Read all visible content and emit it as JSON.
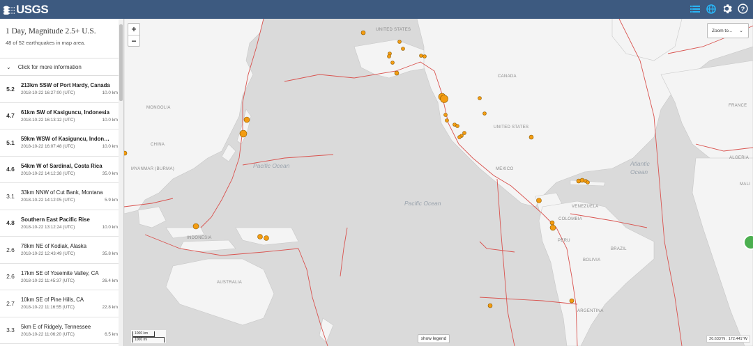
{
  "header": {
    "logo_text": "USGS",
    "icons": [
      "list-icon",
      "globe-icon",
      "gear-icon",
      "help-icon"
    ]
  },
  "sidebar": {
    "title": "1 Day, Magnitude 2.5+ U.S.",
    "subtitle": "48 of 52 earthquakes in map area.",
    "more_info": "Click for more information",
    "earthquakes": [
      {
        "mag": "5.2",
        "place": "213km SSW of Port Hardy, Canada",
        "time": "2018-10-22 16:27:00 (UTC)",
        "depth": "10.0 km"
      },
      {
        "mag": "4.7",
        "place": "61km SW of Kasiguncu, Indonesia",
        "time": "2018-10-22 16:13:12 (UTC)",
        "depth": "10.0 km"
      },
      {
        "mag": "5.1",
        "place": "59km WSW of Kasiguncu, Indon…",
        "time": "2018-10-22 16:07:48 (UTC)",
        "depth": "10.0 km"
      },
      {
        "mag": "4.6",
        "place": "54km W of Sardinal, Costa Rica",
        "time": "2018-10-22 14:12:38 (UTC)",
        "depth": "35.0 km"
      },
      {
        "mag": "3.1",
        "place": "33km NNW of Cut Bank, Montana",
        "time": "2018-10-22 14:12:05 (UTC)",
        "depth": "5.9 km"
      },
      {
        "mag": "4.8",
        "place": "Southern East Pacific Rise",
        "time": "2018-10-22 13:12:24 (UTC)",
        "depth": "10.0 km"
      },
      {
        "mag": "2.6",
        "place": "78km NE of Kodiak, Alaska",
        "time": "2018-10-22 12:43:49 (UTC)",
        "depth": "35.8 km"
      },
      {
        "mag": "2.6",
        "place": "17km SE of Yosemite Valley, CA",
        "time": "2018-10-22 11:45:37 (UTC)",
        "depth": "26.4 km"
      },
      {
        "mag": "2.7",
        "place": "10km SE of Pine Hills, CA",
        "time": "2018-10-22 11:16:55 (UTC)",
        "depth": "22.8 km"
      },
      {
        "mag": "3.3",
        "place": "5km E of Ridgely, Tennessee",
        "time": "2018-10-22 11:06:20 (UTC)",
        "depth": "6.5 km"
      }
    ]
  },
  "map": {
    "zoom_in": "+",
    "zoom_out": "−",
    "zoom_to": "Zoom to...",
    "legend_button": "show legend",
    "scale_km": "1000 km",
    "scale_mi": "1000 mi",
    "coordinates": "20.633°N : 172.441°W",
    "labels": {
      "united_states_top": "UNITED STATES",
      "canada": "CANADA",
      "mongolia": "MONGOLIA",
      "china": "CHINA",
      "myanmar": "MYANMAR (BURMA)",
      "indonesia": "INDONESIA",
      "australia": "AUSTRALIA",
      "united_states": "UNITED STATES",
      "mexico": "MEXICO",
      "venezuela": "VENEZUELA",
      "colombia": "COLOMBIA",
      "peru": "PERU",
      "brazil": "BRAZIL",
      "bolivia": "BOLIVIA",
      "argentina": "ARGENTINA",
      "france": "FRANCE",
      "algeria": "ALGERIA",
      "mali": "MALI",
      "pacific_ocean_w": "Pacific Ocean",
      "pacific_ocean_c": "Pacific Ocean",
      "atlantic_ocean": "Atlantic Ocean"
    },
    "colors": {
      "land": "#f5f5f5",
      "water": "#d9d9d9",
      "plate_boundary": "#d9534f",
      "quake": "#f39c12"
    }
  }
}
